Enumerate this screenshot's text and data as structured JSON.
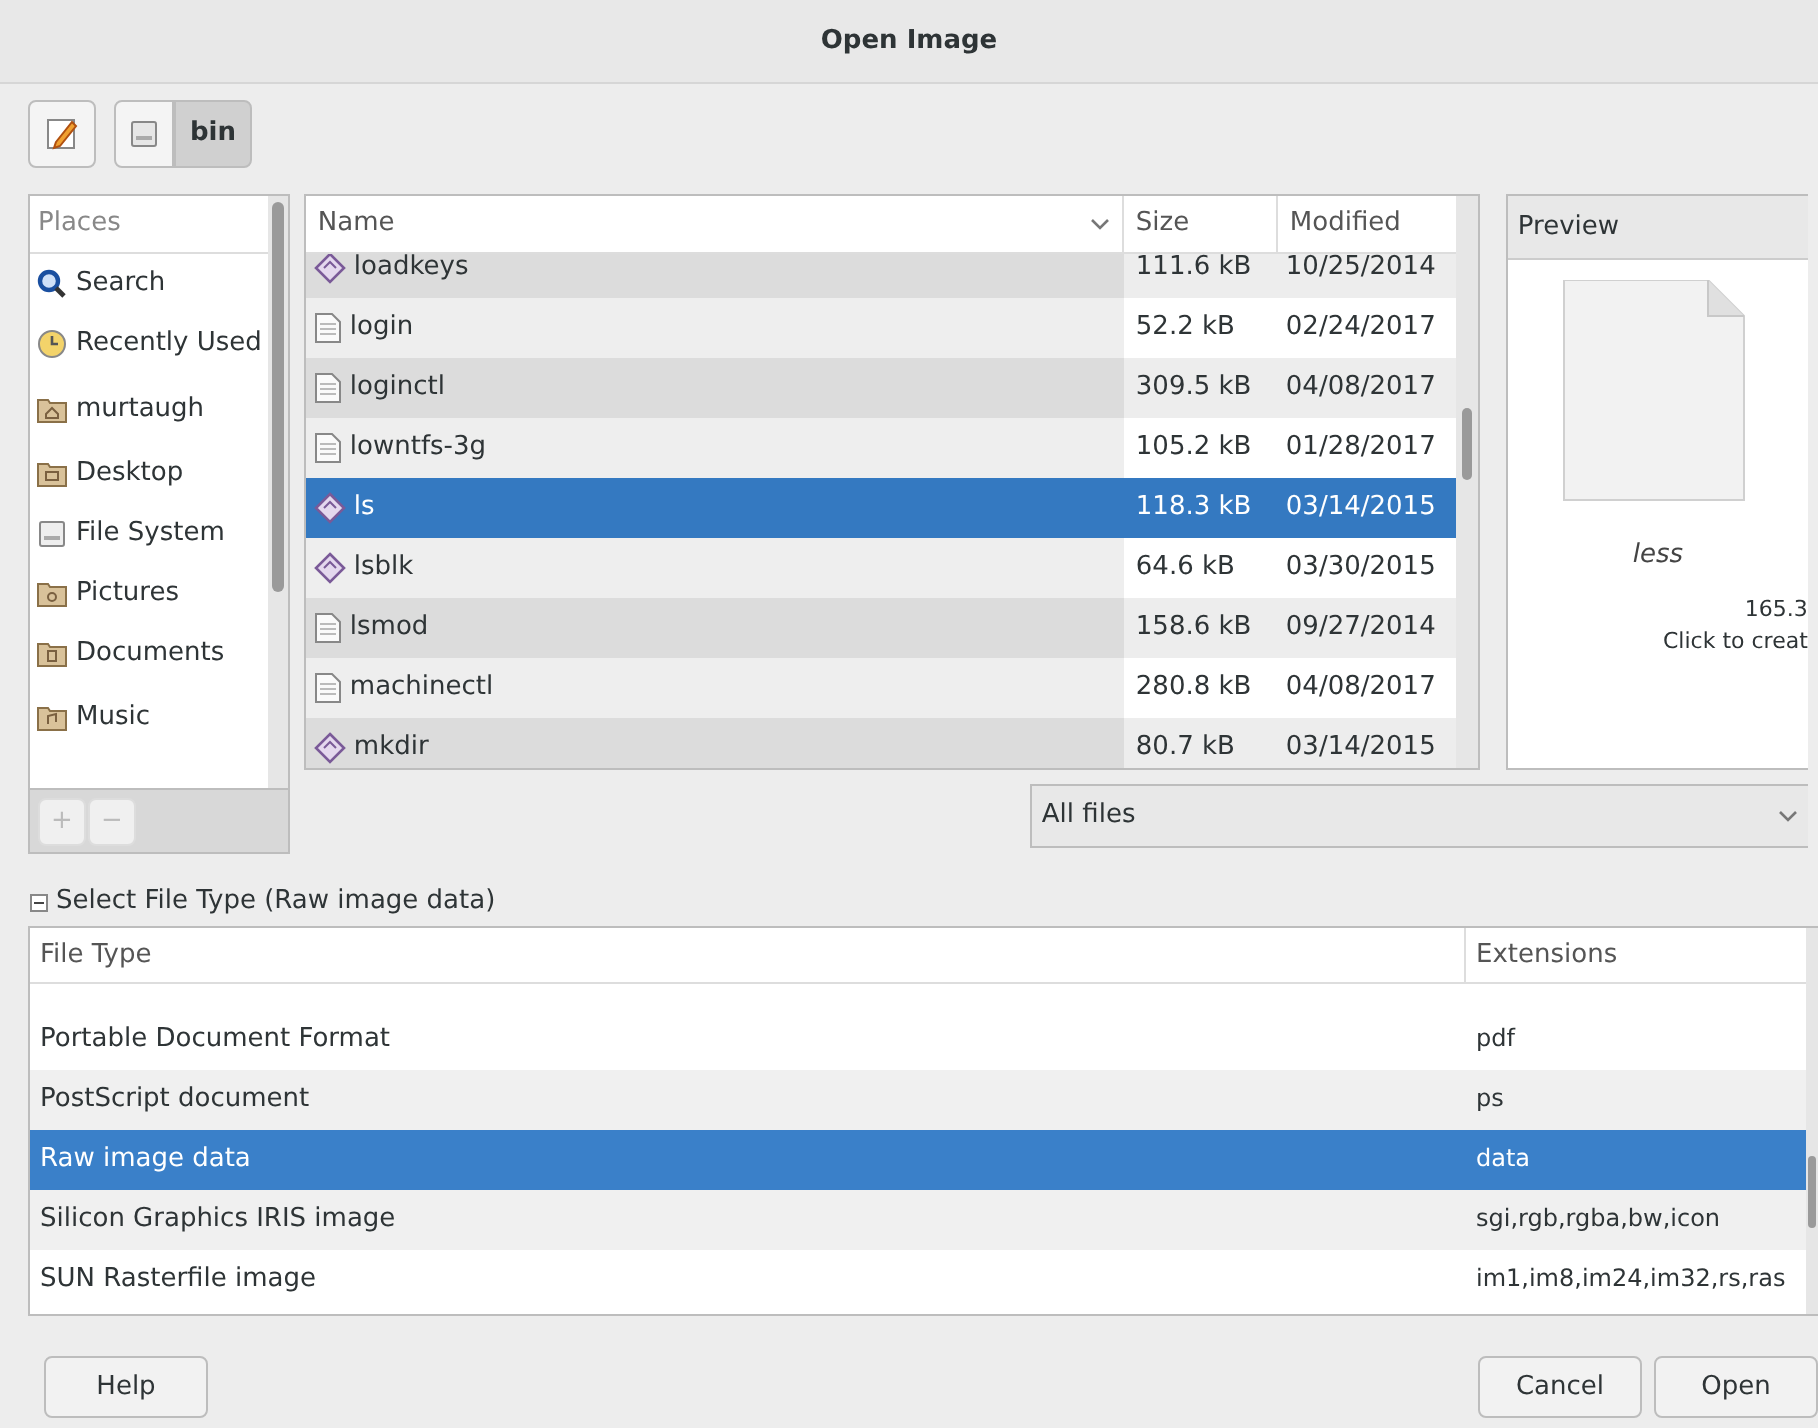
{
  "window": {
    "title": "Open Image"
  },
  "toolbar": {
    "path": [
      {
        "kind": "drive",
        "selected": false
      },
      {
        "label": "bin",
        "kind": "folder",
        "selected": true
      }
    ]
  },
  "places": {
    "header": "Places",
    "items": [
      {
        "label": "Search",
        "kind": "search"
      },
      {
        "label": "Recently Used",
        "kind": "recent"
      },
      {
        "label": "murtaugh",
        "kind": "home"
      },
      {
        "label": "Desktop",
        "kind": "desktop"
      },
      {
        "label": "File System",
        "kind": "drive"
      },
      {
        "label": "Pictures",
        "kind": "pictures"
      },
      {
        "label": "Documents",
        "kind": "documents"
      },
      {
        "label": "Music",
        "kind": "music"
      }
    ],
    "buttons": [
      {
        "label": "+",
        "disabled": true
      },
      {
        "label": "−",
        "disabled": true
      }
    ]
  },
  "files": {
    "columns": [
      "Name",
      "Size",
      "Modified"
    ],
    "rows": [
      {
        "name": "loadkeys",
        "kind": "executable",
        "size": "111.6 kB",
        "modified": "10/25/2014",
        "selected": false
      },
      {
        "name": "login",
        "kind": "text",
        "size": "52.2 kB",
        "modified": "02/24/2017",
        "selected": false
      },
      {
        "name": "loginctl",
        "kind": "text",
        "size": "309.5 kB",
        "modified": "04/08/2017",
        "selected": false
      },
      {
        "name": "lowntfs-3g",
        "kind": "text",
        "size": "105.2 kB",
        "modified": "01/28/2017",
        "selected": false
      },
      {
        "name": "ls",
        "kind": "executable",
        "size": "118.3 kB",
        "modified": "03/14/2015",
        "selected": true
      },
      {
        "name": "lsblk",
        "kind": "executable",
        "size": "64.6 kB",
        "modified": "03/30/2015",
        "selected": false
      },
      {
        "name": "lsmod",
        "kind": "text",
        "size": "158.6 kB",
        "modified": "09/27/2014",
        "selected": false
      },
      {
        "name": "machinectl",
        "kind": "text",
        "size": "280.8 kB",
        "modified": "04/08/2017",
        "selected": false
      },
      {
        "name": "mkdir",
        "kind": "executable",
        "size": "80.7 kB",
        "modified": "03/14/2015",
        "selected": false
      }
    ]
  },
  "preview": {
    "header": "Preview",
    "name": "less",
    "size": "165.3",
    "hint": "Click to creat"
  },
  "filter": {
    "value": "All files"
  },
  "file_type": {
    "expander": "Select File Type (Raw image data)",
    "expanded": true,
    "columns": [
      "File Type",
      "Extensions"
    ],
    "rows": [
      {
        "type": "Portable Document Format",
        "extensions": "pdf",
        "selected": false
      },
      {
        "type": "PostScript document",
        "extensions": "ps",
        "selected": false
      },
      {
        "type": "Raw image data",
        "extensions": "data",
        "selected": true
      },
      {
        "type": "Silicon Graphics IRIS image",
        "extensions": "sgi,rgb,rgba,bw,icon",
        "selected": false
      },
      {
        "type": "SUN Rasterfile image",
        "extensions": "im1,im8,im24,im32,rs,ras",
        "selected": false
      }
    ]
  },
  "buttons": {
    "help": "Help",
    "cancel": "Cancel",
    "open": "Open"
  }
}
